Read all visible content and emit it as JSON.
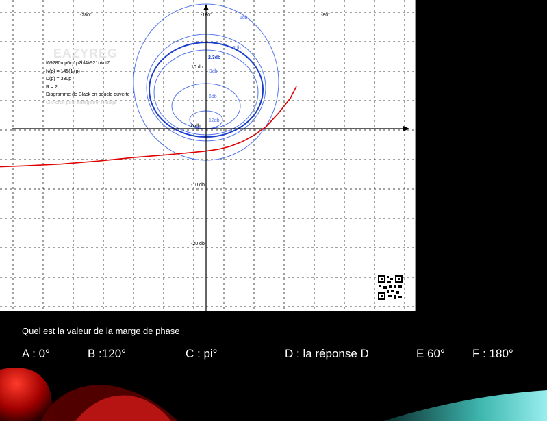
{
  "chart_data": {
    "type": "line",
    "title": "Diagramme de Black en boucle ouverte",
    "x_tick_labels": [
      "-280°",
      "-180°",
      "-80°"
    ],
    "y_tick_labels": [
      "10 db",
      "0 db",
      "-10 db",
      "-20 db"
    ],
    "nichols_contours": [
      {
        "label": "1db",
        "gain_db": 1
      },
      {
        "label": "2db",
        "gain_db": 2
      },
      {
        "label": "2.3db",
        "gain_db": 2.3,
        "highlighted": true
      },
      {
        "label": "3db",
        "gain_db": 3
      },
      {
        "label": "6db",
        "gain_db": 6
      },
      {
        "label": "12db",
        "gain_db": 12
      }
    ],
    "series": [
      {
        "color": "#e00000",
        "points": [
          {
            "phase": -355,
            "gain": -6.5
          },
          {
            "phase": -330,
            "gain": -6.3
          },
          {
            "phase": -300,
            "gain": -6.0
          },
          {
            "phase": -270,
            "gain": -5.5
          },
          {
            "phase": -240,
            "gain": -4.9
          },
          {
            "phase": -210,
            "gain": -4.4
          },
          {
            "phase": -195,
            "gain": -4.1
          },
          {
            "phase": -180,
            "gain": -3.8
          },
          {
            "phase": -170,
            "gain": -3.5
          },
          {
            "phase": -160,
            "gain": -3.0
          },
          {
            "phase": -150,
            "gain": -2.2
          },
          {
            "phase": -140,
            "gain": -1.1
          },
          {
            "phase": -130,
            "gain": 0.4
          },
          {
            "phase": -120,
            "gain": 2.6
          },
          {
            "phase": -110,
            "gain": 5.2
          },
          {
            "phase": -105,
            "gain": 7.2
          }
        ]
      }
    ],
    "grid": true
  },
  "info": {
    "id": "f69280mp6cj1p2bl4k921ukct7",
    "np": "N(p) = 145(1+p)",
    "dp": "D(p) = 330p",
    "r": "R = 2",
    "title": "Diagramme de Black en boucle ouverte",
    "hint": "Clic-droit pour enregistrer l'image",
    "watermark": "EAZYREG"
  },
  "question": {
    "text": "Quel est la valeur de la marge de phase",
    "answers": [
      "A : 0°",
      "B :120°",
      "C : pi°",
      "D : la réponse D",
      "E 60°",
      "F : 180°"
    ]
  },
  "colors": {
    "contour": "#5577ee",
    "contour_bold": "#1a3fcc",
    "curve": "#e00000",
    "grid": "#444444"
  }
}
